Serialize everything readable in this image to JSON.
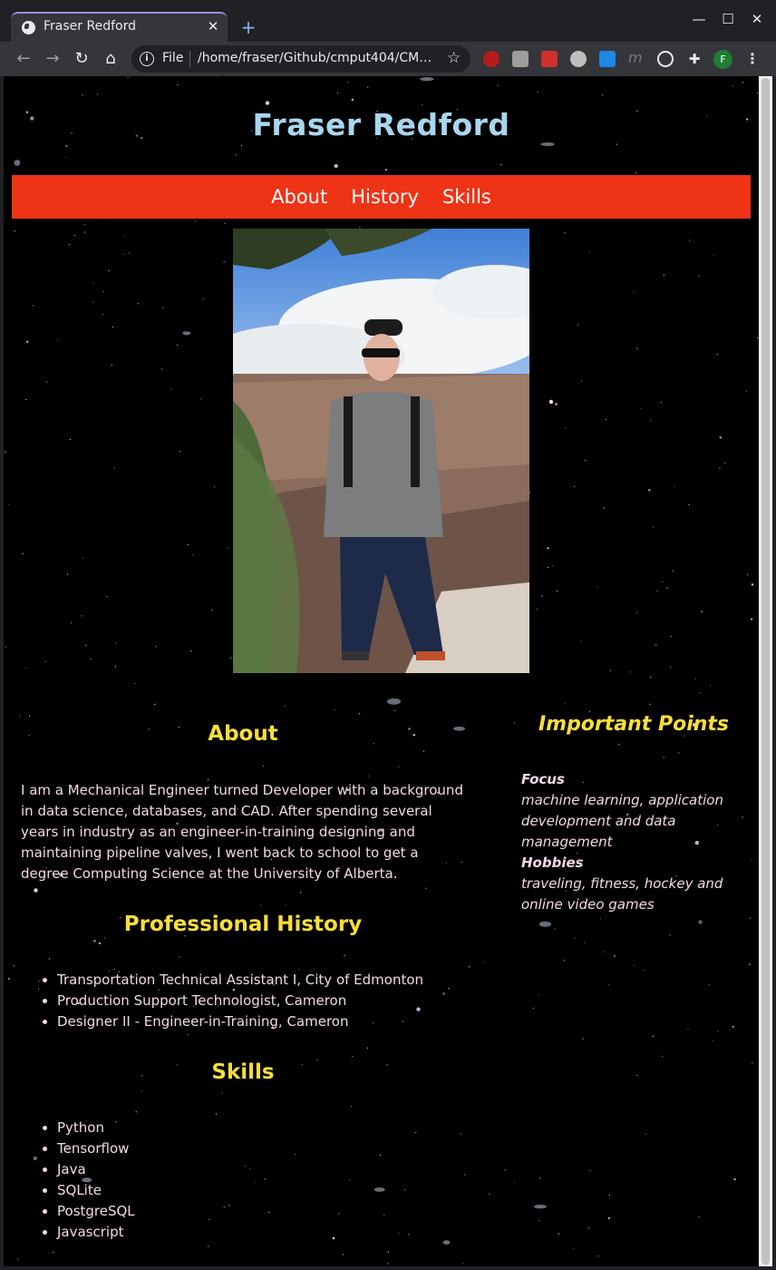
{
  "browser": {
    "tab_title": "Fraser Redford",
    "url_scheme": "File",
    "url": "/home/fraser/Github/cmput404/CMP…",
    "profile_initial": "F",
    "icons": [
      "back-icon",
      "forward-icon",
      "reload-icon",
      "home-icon",
      "info-icon",
      "star-icon",
      "extensions-icon",
      "menu-icon"
    ]
  },
  "page": {
    "title": "Fraser Redford",
    "nav": [
      {
        "label": "About"
      },
      {
        "label": "History"
      },
      {
        "label": "Skills"
      }
    ],
    "about": {
      "heading": "About",
      "text": "I am a Mechanical Engineer turned Developer with a background in data science, databases, and CAD. After spending several years in industry as an engineer-in-training designing and maintaining pipeline valves, I went back to school to get a degree Computing Science at the University of Alberta."
    },
    "history": {
      "heading": "Professional History",
      "items": [
        "Transportation Technical Assistant I, City of Edmonton",
        "Production Support Technologist, Cameron",
        "Designer II - Engineer-in-Training, Cameron"
      ]
    },
    "skills": {
      "heading": "Skills",
      "items": [
        "Python",
        "Tensorflow",
        "Java",
        "SQLite",
        "PostgreSQL",
        "Javascript"
      ]
    },
    "important": {
      "heading": "Important Points",
      "focus_term": "Focus",
      "focus_value": "machine learning, application development and data management",
      "hobbies_term": "Hobbies",
      "hobbies_value": "traveling, fitness, hockey and online video games"
    }
  },
  "colors": {
    "nav_bg": "#ee3316",
    "title": "#a9d6ef",
    "heading": "#f7de3c",
    "body_text": "#f0d9e6"
  }
}
